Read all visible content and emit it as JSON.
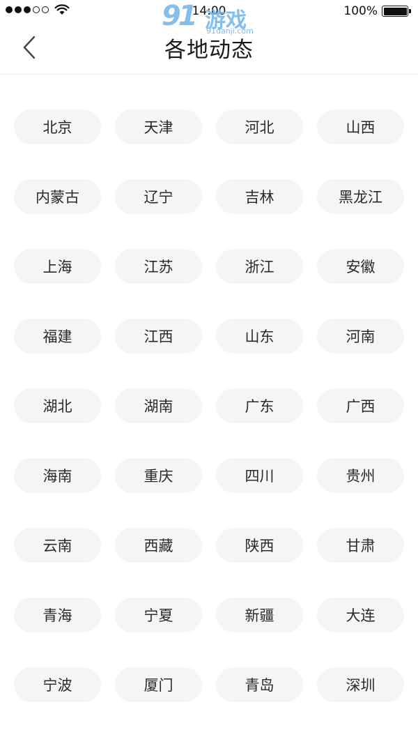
{
  "status_bar": {
    "time": "14:00",
    "battery_percent": "100%",
    "signal_bars_filled": 3,
    "signal_bars_total": 5
  },
  "watermark": {
    "brand_number": "91",
    "brand_text": "游戏",
    "url": "91danji.com"
  },
  "header": {
    "title": "各地动态",
    "back_icon": "chevron-left-icon"
  },
  "regions": [
    "北京",
    "天津",
    "河北",
    "山西",
    "内蒙古",
    "辽宁",
    "吉林",
    "黑龙江",
    "上海",
    "江苏",
    "浙江",
    "安徽",
    "福建",
    "江西",
    "山东",
    "河南",
    "湖北",
    "湖南",
    "广东",
    "广西",
    "海南",
    "重庆",
    "四川",
    "贵州",
    "云南",
    "西藏",
    "陕西",
    "甘肃",
    "青海",
    "宁夏",
    "新疆",
    "大连",
    "宁波",
    "厦门",
    "青岛",
    "深圳"
  ],
  "colors": {
    "chip_background": "#f5f5f8",
    "watermark": "#6fb3ea"
  }
}
